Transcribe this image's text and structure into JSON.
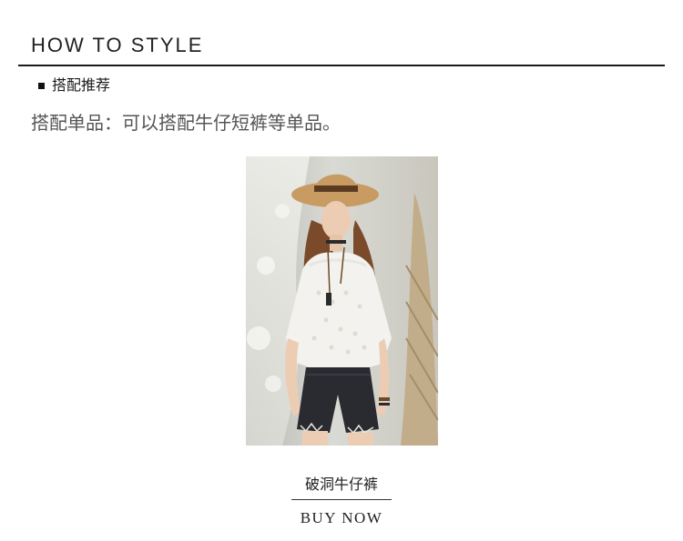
{
  "section": {
    "title": "HOW TO STYLE",
    "subheading": "搭配推荐",
    "description": "搭配单品：可以搭配牛仔短裤等单品。"
  },
  "product": {
    "name": "破洞牛仔裤",
    "cta_label": "BUY NOW"
  }
}
